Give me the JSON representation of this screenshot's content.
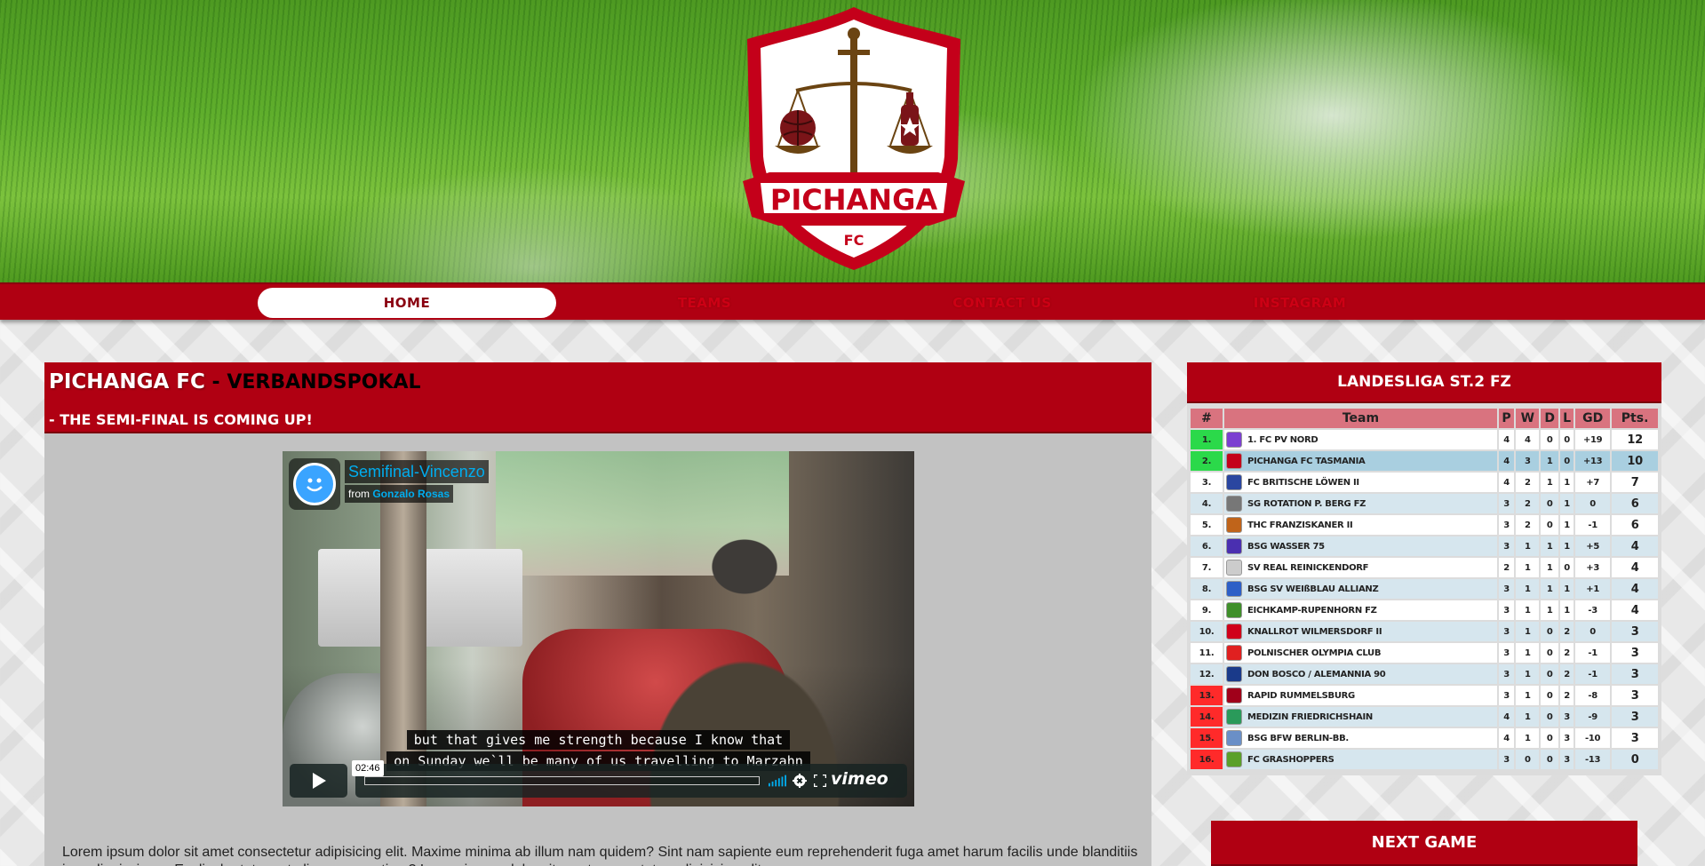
{
  "brand": {
    "name": "PICHANGA",
    "sub": "FC"
  },
  "nav": {
    "items": [
      {
        "label": "HOME",
        "active": true
      },
      {
        "label": "TEAMS",
        "active": false
      },
      {
        "label": "CONTACT US",
        "active": false
      },
      {
        "label": "INSTAGRAM",
        "active": false
      }
    ]
  },
  "article": {
    "title_main": "PICHANGA FC",
    "title_sub": " - VERBANDSPOKAL",
    "subtitle": "- THE SEMI-FINAL IS COMING UP!",
    "body": "Lorem ipsum dolor sit amet consectetur adipisicing elit. Maxime minima ab illum nam quidem? Sint nam sapiente eum reprehenderit fuga amet harum facilis unde blanditiis ipsa dignissimos. Explicabo totam at alias accusantium? Lorem ipsum dolor sit amet consectetur adipisicing elit."
  },
  "video": {
    "title": "Semifinal-Vincenzo",
    "from_label": "from",
    "author": "Gonzalo Rosas",
    "subtitle_line1": "but that gives me strength because I know that",
    "subtitle_line2": "on Sunday we`ll be many of us travelling to Marzahn",
    "duration": "02:46",
    "progress": 0,
    "brand": "vimeo",
    "accent": "#00adef"
  },
  "league": {
    "title": "LANDESLIGA ST.2 FZ",
    "columns": [
      "#",
      "Team",
      "P",
      "W",
      "D",
      "L",
      "GD",
      "Pts."
    ],
    "rows": [
      {
        "rank": "1.",
        "team": "1. FC PV NORD",
        "p": "4",
        "w": "4",
        "d": "0",
        "l": "0",
        "gd": "+19",
        "pts": "12",
        "zone": "g",
        "crest": "#7b3fd1"
      },
      {
        "rank": "2.",
        "team": "PICHANGA FC TASMANIA",
        "p": "4",
        "w": "3",
        "d": "1",
        "l": "0",
        "gd": "+13",
        "pts": "10",
        "zone": "g",
        "crest": "#c4001a",
        "highlight": true
      },
      {
        "rank": "3.",
        "team": "FC BRITISCHE LÖWEN II",
        "p": "4",
        "w": "2",
        "d": "1",
        "l": "1",
        "gd": "+7",
        "pts": "7",
        "zone": "",
        "crest": "#2a46a0"
      },
      {
        "rank": "4.",
        "team": "SG ROTATION P. BERG FZ",
        "p": "3",
        "w": "2",
        "d": "0",
        "l": "1",
        "gd": "0",
        "pts": "6",
        "zone": "",
        "crest": "#777777"
      },
      {
        "rank": "5.",
        "team": "THC FRANZISKANER II",
        "p": "3",
        "w": "2",
        "d": "0",
        "l": "1",
        "gd": "-1",
        "pts": "6",
        "zone": "",
        "crest": "#c0641a"
      },
      {
        "rank": "6.",
        "team": "BSG WASSER 75",
        "p": "3",
        "w": "1",
        "d": "1",
        "l": "1",
        "gd": "+5",
        "pts": "4",
        "zone": "",
        "crest": "#4a2fb0"
      },
      {
        "rank": "7.",
        "team": "SV REAL REINICKENDORF",
        "p": "2",
        "w": "1",
        "d": "1",
        "l": "0",
        "gd": "+3",
        "pts": "4",
        "zone": "",
        "crest": "#cccccc"
      },
      {
        "rank": "8.",
        "team": "BSG SV WEIßBLAU ALLIANZ",
        "p": "3",
        "w": "1",
        "d": "1",
        "l": "1",
        "gd": "+1",
        "pts": "4",
        "zone": "",
        "crest": "#2d5fc7"
      },
      {
        "rank": "9.",
        "team": "EICHKAMP-RUPENHORN FZ",
        "p": "3",
        "w": "1",
        "d": "1",
        "l": "1",
        "gd": "-3",
        "pts": "4",
        "zone": "",
        "crest": "#3f8f2a"
      },
      {
        "rank": "10.",
        "team": "KNALLROT WILMERSDORF II",
        "p": "3",
        "w": "1",
        "d": "0",
        "l": "2",
        "gd": "0",
        "pts": "3",
        "zone": "",
        "crest": "#d0001a"
      },
      {
        "rank": "11.",
        "team": "POLNISCHER OLYMPIA CLUB",
        "p": "3",
        "w": "1",
        "d": "0",
        "l": "2",
        "gd": "-1",
        "pts": "3",
        "zone": "",
        "crest": "#e02020"
      },
      {
        "rank": "12.",
        "team": "DON BOSCO / ALEMANNIA 90",
        "p": "3",
        "w": "1",
        "d": "0",
        "l": "2",
        "gd": "-1",
        "pts": "3",
        "zone": "",
        "crest": "#1a3a8a"
      },
      {
        "rank": "13.",
        "team": "RAPID RUMMELSBURG",
        "p": "3",
        "w": "1",
        "d": "0",
        "l": "2",
        "gd": "-8",
        "pts": "3",
        "zone": "r",
        "crest": "#a0001a"
      },
      {
        "rank": "14.",
        "team": "MEDIZIN FRIEDRICHSHAIN",
        "p": "4",
        "w": "1",
        "d": "0",
        "l": "3",
        "gd": "-9",
        "pts": "3",
        "zone": "r",
        "crest": "#2a9a5a"
      },
      {
        "rank": "15.",
        "team": "BSG BFW BERLIN-BB.",
        "p": "4",
        "w": "1",
        "d": "0",
        "l": "3",
        "gd": "-10",
        "pts": "3",
        "zone": "r",
        "crest": "#6a8fc7"
      },
      {
        "rank": "16.",
        "team": "FC GRASHOPPERS",
        "p": "3",
        "w": "0",
        "d": "0",
        "l": "3",
        "gd": "-13",
        "pts": "0",
        "zone": "r",
        "crest": "#5aa02a"
      }
    ]
  },
  "next_game": {
    "title": "NEXT GAME"
  }
}
